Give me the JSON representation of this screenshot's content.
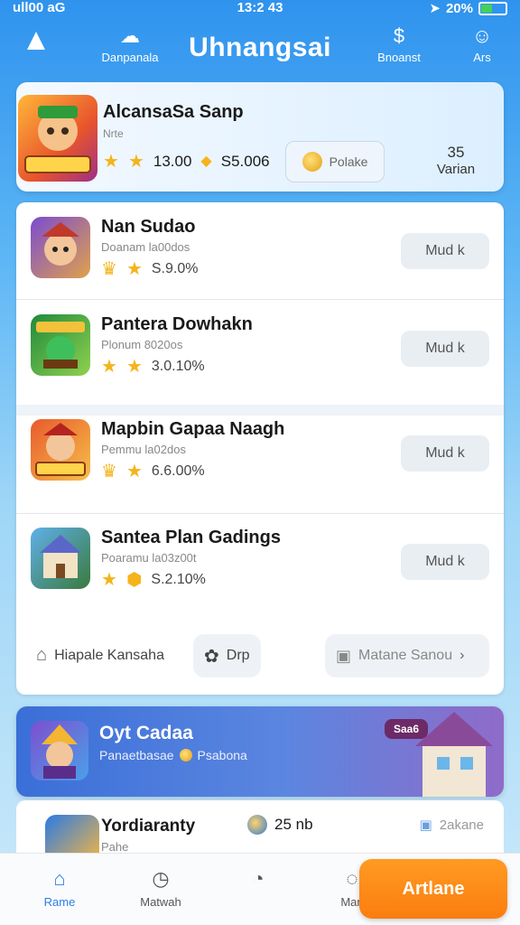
{
  "status_bar": {
    "carrier": "ull00 aG",
    "time": "13:2 43",
    "battery": "20%"
  },
  "header": {
    "title": "Uhnangsai",
    "left_label": "Danpanala",
    "right1_label": "Bnoanst",
    "right2_label": "Ars"
  },
  "featured": {
    "name": "AlcansaSa Sanp",
    "sub": "Nrte",
    "stat1": "13.00",
    "stat2": "S5.006",
    "button_label": "Polake",
    "count_num": "35",
    "count_label": "Varian"
  },
  "items": [
    {
      "name": "Nan Sudao",
      "sub": "Doanam la00dos",
      "stat": "S.9.0%",
      "button": "Mud k"
    },
    {
      "name": "Pantera Dowhakn",
      "sub": "Plonum 8020os",
      "stat": "3.0.10%",
      "button": "Mud k"
    },
    {
      "name": "Mapbin Gapaa Naagh",
      "sub": "Pemmu la02dos",
      "stat": "6.6.00%",
      "button": "Mud k"
    },
    {
      "name": "Santea Plan Gadings",
      "sub": "Poaramu la03z00t",
      "stat": "S.2.10%",
      "button": "Mud k"
    }
  ],
  "bottom_row": {
    "left_label": "Hiapale Kansaha",
    "mid_label": "Drp",
    "right_label": "Matane Sanou"
  },
  "promo": {
    "name": "Oyt Cadaa",
    "sub_left": "Panaetbasae",
    "sub_right": "Psabona",
    "badge": "Saa6"
  },
  "partial": {
    "name": "Yordiaranty",
    "sub": "Pahe",
    "mid": "25 nb",
    "right": "2akane"
  },
  "tabbar": {
    "tab1": "Rame",
    "tab2": "Matwah",
    "tab3": "",
    "tab4": "Man",
    "cta": "Artlane"
  }
}
